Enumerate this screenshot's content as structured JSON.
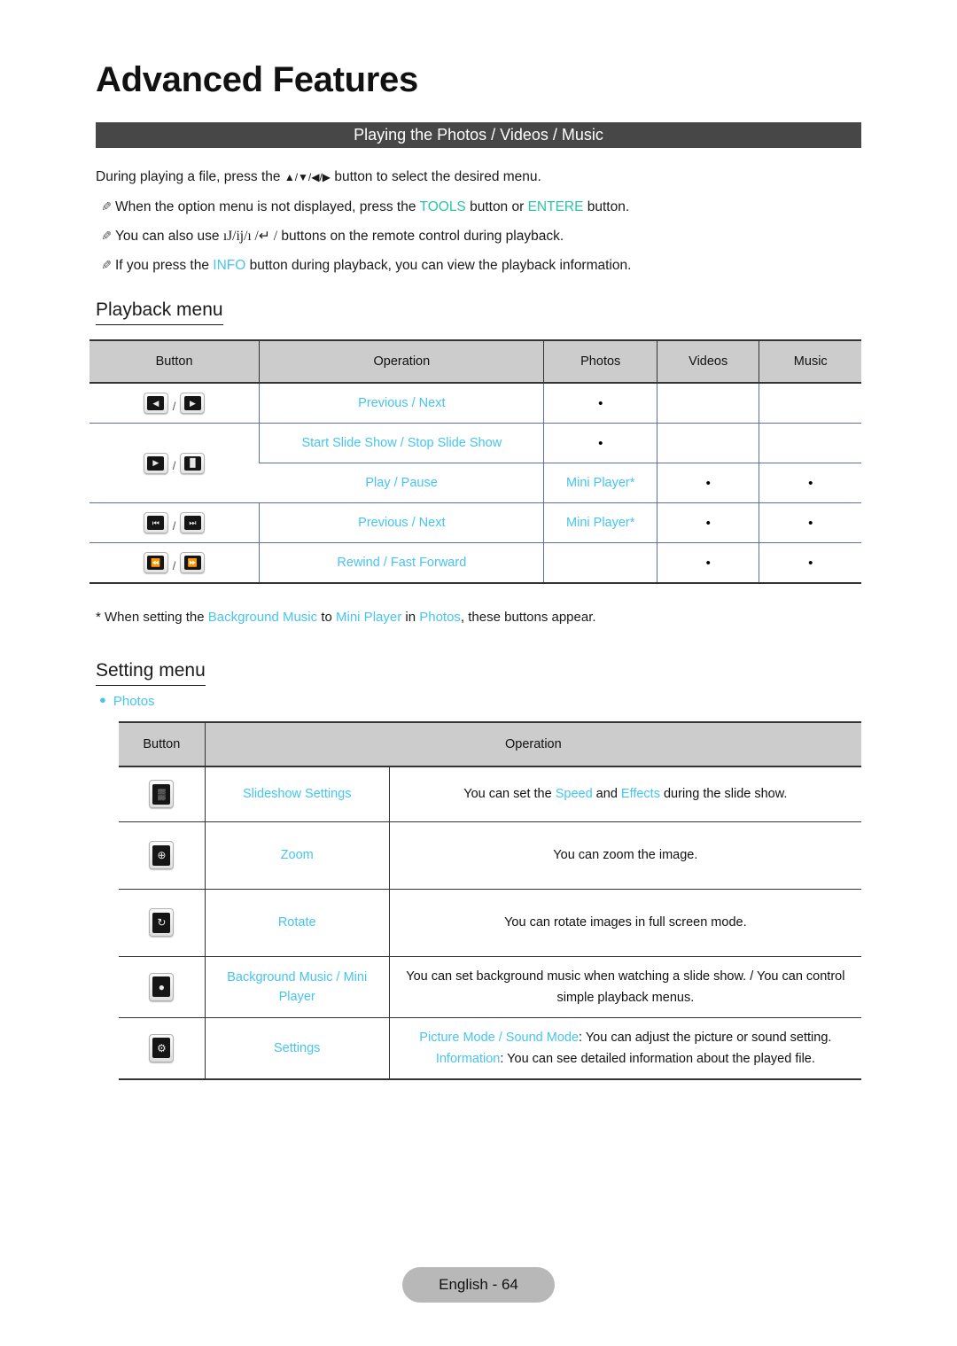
{
  "document": {
    "chapter_title": "Advanced Features",
    "section_bar_title": "Playing the Photos / Videos / Music",
    "footer_label": "English - 64"
  },
  "intro": {
    "line1_a": "During playing a file, press the ",
    "line1_arrows": "▲/▼/◀/▶",
    "line1_b": " button to select the desired menu.",
    "note1_a": "When the option menu is not displayed, press the ",
    "note1_tools": "TOOLS",
    "note1_b": " button or ",
    "note1_enter": "ENTERE",
    "note1_c": " button.",
    "note2_a": "You can also use ",
    "note2_glyphs": "ıJ/ij/ı /↵  /",
    "note2_b": " buttons on the remote control during playback.",
    "note3_a": "If you press the ",
    "note3_info": "INFO",
    "note3_b": " button during playback, you can view the playback information."
  },
  "playback_menu": {
    "heading": "Playback menu",
    "columns": [
      "Button",
      "Operation",
      "Photos",
      "Videos",
      "Music"
    ],
    "rows": [
      {
        "icons": [
          "prev-arrow-icon",
          "next-arrow-icon"
        ],
        "icon_glyphs": [
          "◀",
          "▶"
        ],
        "operation": "Previous / Next",
        "photos": "•",
        "videos": "",
        "music": ""
      },
      {
        "icons": [
          "play-icon",
          "pause-icon"
        ],
        "icon_glyphs": [
          "▶",
          "▐▌"
        ],
        "operation": "Start Slide Show / Stop Slide Show",
        "photos": "•",
        "videos": "",
        "music": ""
      },
      {
        "icons": [],
        "icon_glyphs": [],
        "operation": "Play / Pause",
        "photos": "Mini Player*",
        "videos": "•",
        "music": "•"
      },
      {
        "icons": [
          "skip-previous-icon",
          "skip-next-icon"
        ],
        "icon_glyphs": [
          "⏮",
          "⏭"
        ],
        "operation": "Previous / Next",
        "photos": "Mini Player*",
        "videos": "•",
        "music": "•"
      },
      {
        "icons": [
          "rewind-icon",
          "fast-forward-icon"
        ],
        "icon_glyphs": [
          "⏪",
          "⏩"
        ],
        "operation": "Rewind / Fast Forward",
        "photos": "",
        "videos": "•",
        "music": "•"
      }
    ],
    "footnote_a": "* When setting the ",
    "footnote_bgm": "Background Music",
    "footnote_b": " to ",
    "footnote_mini": "Mini Player",
    "footnote_c": " in ",
    "footnote_photos": "Photos",
    "footnote_d": ", these buttons appear."
  },
  "setting_menu": {
    "heading": "Setting menu",
    "bullet_label": "Photos",
    "columns": [
      "Button",
      "Operation"
    ],
    "rows": [
      {
        "icon": "slideshow-settings-icon",
        "icon_glyph": "▒",
        "name": "Slideshow Settings",
        "desc_a": "You can set the ",
        "desc_hl1": "Speed",
        "desc_b": " and ",
        "desc_hl2": "Effects",
        "desc_c": " during the slide show."
      },
      {
        "icon": "zoom-icon",
        "icon_glyph": "⊕",
        "name": "Zoom",
        "desc_a": "You can zoom the image.",
        "desc_hl1": "",
        "desc_b": "",
        "desc_hl2": "",
        "desc_c": ""
      },
      {
        "icon": "rotate-icon",
        "icon_glyph": "↻",
        "name": "Rotate",
        "desc_a": "You can rotate images in full screen mode.",
        "desc_hl1": "",
        "desc_b": "",
        "desc_hl2": "",
        "desc_c": ""
      },
      {
        "icon": "background-music-icon",
        "icon_glyph": "●",
        "name": "Background Music / Mini Player",
        "desc_a": "You can set background music when watching a slide show. / You can control simple playback menus.",
        "desc_hl1": "",
        "desc_b": "",
        "desc_hl2": "",
        "desc_c": ""
      },
      {
        "icon": "settings-gear-icon",
        "icon_glyph": "⚙",
        "name": "Settings",
        "desc_line1_hl": "Picture Mode / Sound Mode",
        "desc_line1_rest": ": You can adjust the picture or sound setting.",
        "desc_line2_hl": "Information",
        "desc_line2_rest": ": You can see detailed information about the played file."
      }
    ]
  },
  "colors": {
    "accent_cyan": "#45c5f0",
    "accent_teal": "#2bc4a8",
    "section_bar": "#474747",
    "table_header": "#cccccc",
    "table_rule_blue": "#5b6fa8",
    "footer_pill": "#b8b8b8"
  }
}
